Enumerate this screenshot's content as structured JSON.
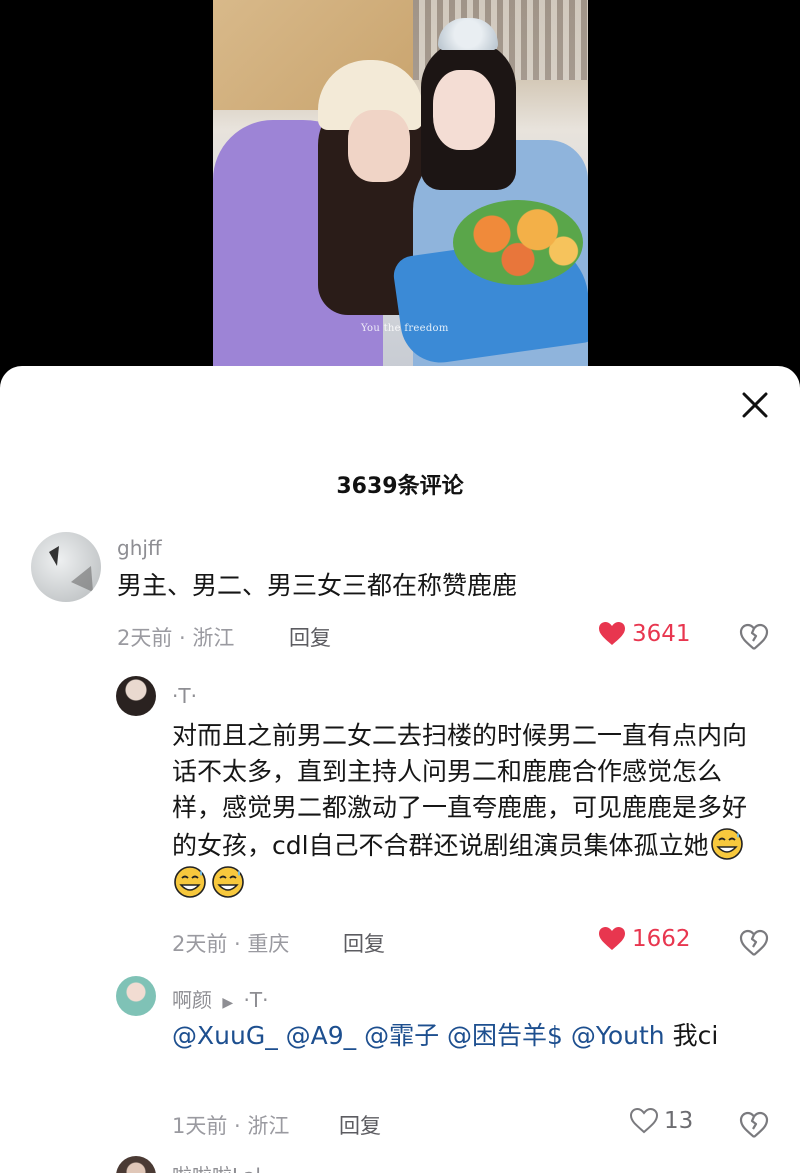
{
  "video": {
    "watermark": "You the freedom"
  },
  "sheet": {
    "title": "3639条评论",
    "close_icon": "close-icon"
  },
  "comments": [
    {
      "username": "ghjff",
      "text": "男主、男二、男三女三都在称赞鹿鹿",
      "time_location": "2天前 · 浙江",
      "reply_label": "回复",
      "likes": "3641",
      "liked": true
    },
    {
      "username": "·T·",
      "text": "对而且之前男二女二去扫楼的时候男二一直有点内向话不太多，直到主持人问男二和鹿鹿合作感觉怎么样，感觉男二都激动了一直夸鹿鹿，可见鹿鹿是多好的女孩，cdl自己不合群还说剧组演员集体孤立她",
      "emoji": [
        "sweat-smile-emoji",
        "sweat-smile-emoji",
        "sweat-smile-emoji"
      ],
      "time_location": "2天前 · 重庆",
      "reply_label": "回复",
      "likes": "1662",
      "liked": true
    },
    {
      "username": "啊颜",
      "reply_to": "·T·",
      "mentions": "@XuuG_ @A9_ @霏子 @困告羊$ @Youth",
      "text_after": " 我ci",
      "time_location": "1天前 · 浙江",
      "reply_label": "回复",
      "likes": "13",
      "liked": false
    },
    {
      "username": "啦啦啦Lal"
    }
  ],
  "colors": {
    "like_red": "#e8364f",
    "mention_blue": "#1d4f8f",
    "meta_gray": "#9a9aa0"
  }
}
